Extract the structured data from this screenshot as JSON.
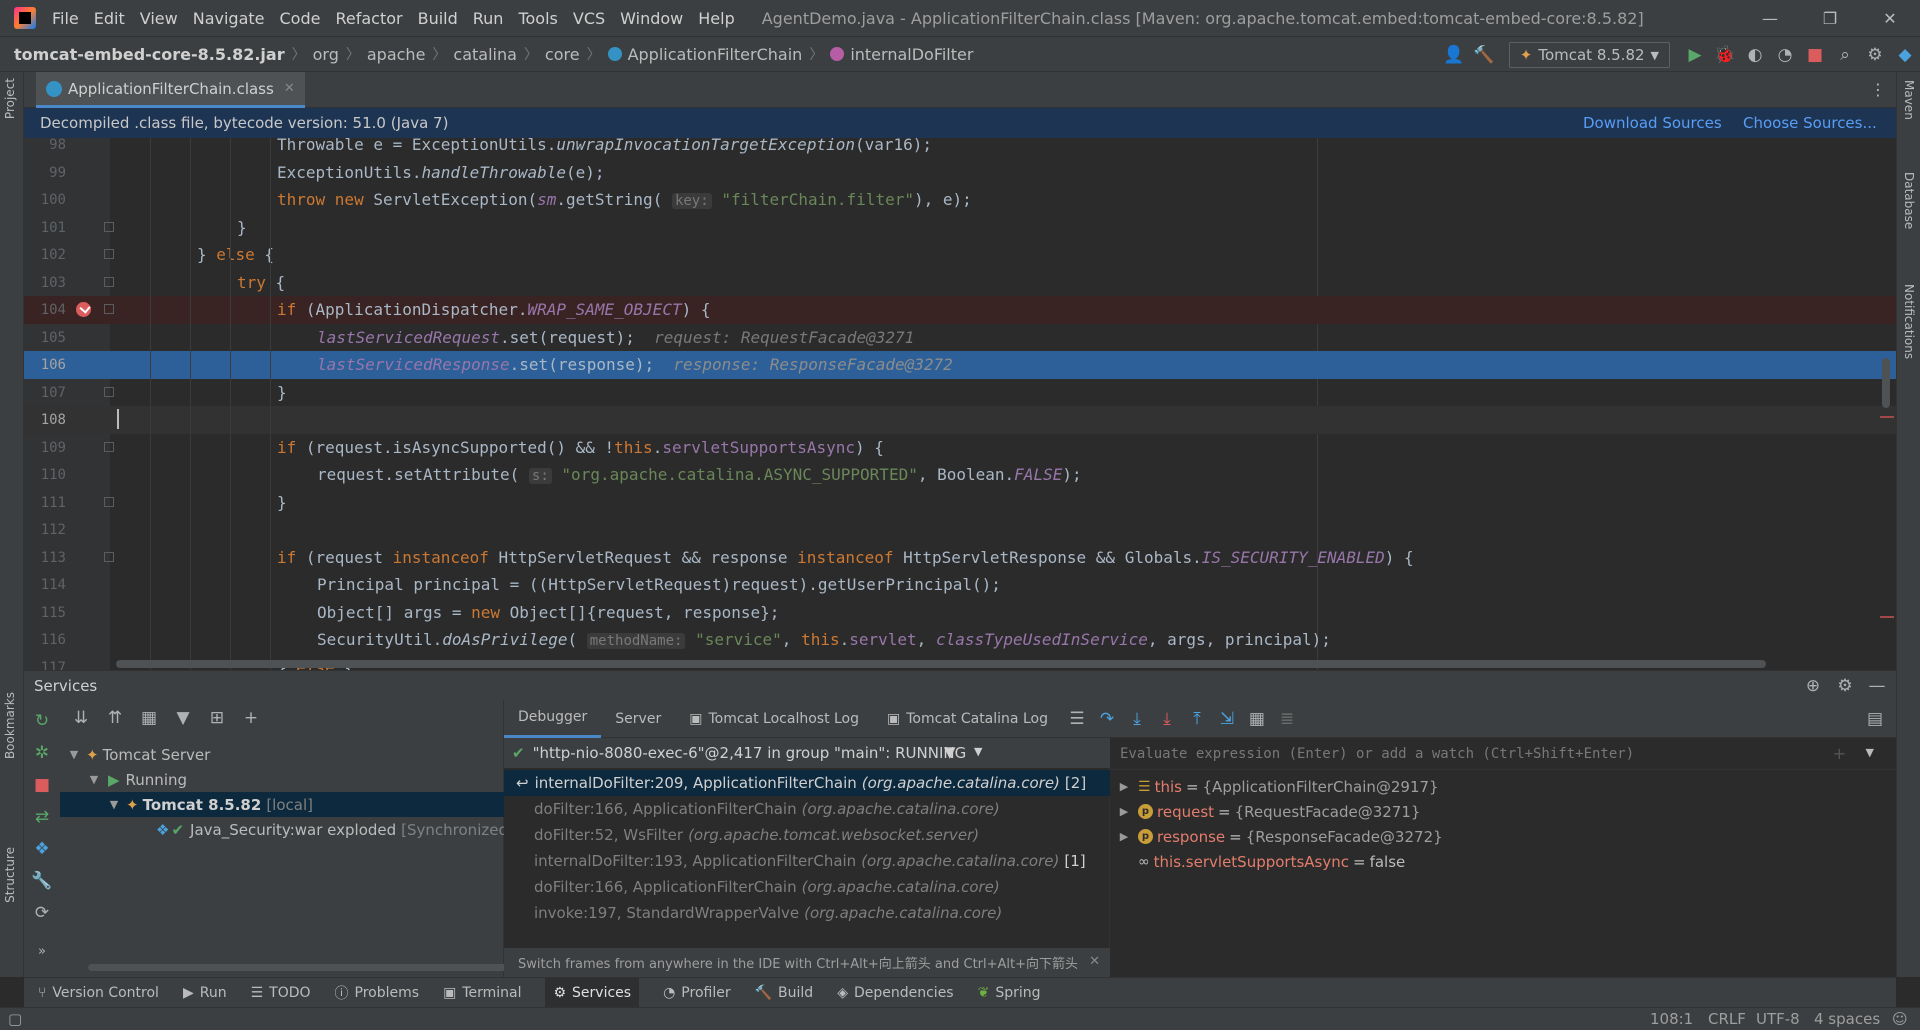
{
  "titlebar": {
    "menu": [
      "File",
      "Edit",
      "View",
      "Navigate",
      "Code",
      "Refactor",
      "Build",
      "Run",
      "Tools",
      "VCS",
      "Window",
      "Help"
    ],
    "title": "AgentDemo.java - ApplicationFilterChain.class [Maven: org.apache.tomcat.embed:tomcat-embed-core:8.5.82]"
  },
  "breadcrumbs": [
    "tomcat-embed-core-8.5.82.jar",
    "org",
    "apache",
    "catalina",
    "core",
    "ApplicationFilterChain",
    "internalDoFilter"
  ],
  "run_config": "Tomcat 8.5.82",
  "left_stripe": {
    "project": "Project",
    "bookmarks": "Bookmarks",
    "structure": "Structure"
  },
  "right_stripe": {
    "maven": "Maven",
    "database": "Database",
    "notifications": "Notifications"
  },
  "editor_tab": "ApplicationFilterChain.class",
  "banner": {
    "text": "Decompiled .class file, bytecode version: 51.0 (Java 7)",
    "download": "Download Sources",
    "choose": "Choose Sources..."
  },
  "code": {
    "l98": "98",
    "l99": "99",
    "l100": "100",
    "l101": "101",
    "l102": "102",
    "l103": "103",
    "l104": "104",
    "l105": "105",
    "l106": "106",
    "l107": "107",
    "l108": "108",
    "l109": "109",
    "l110": "110",
    "l111": "111",
    "l112": "112",
    "l113": "113",
    "l114": "114",
    "l115": "115",
    "l116": "116",
    "l117": "117"
  },
  "services": {
    "title": "Services",
    "tree": {
      "server": "Tomcat Server",
      "running": "Running",
      "tomcat": "Tomcat 8.5.82",
      "tomcat_tag": "[local]",
      "artifact": "Java_Security:war exploded",
      "artifact_tag": "[Synchronized]"
    }
  },
  "debugger": {
    "tabs": [
      "Debugger",
      "Server",
      "Tomcat Localhost Log",
      "Tomcat Catalina Log"
    ],
    "thread": "\"http-nio-8080-exec-6\"@2,417 in group \"main\": RUNNING",
    "frames": [
      {
        "method": "internalDoFilter:209, ApplicationFilterChain",
        "pkg": "(org.apache.catalina.core)",
        "tag": "[2]"
      },
      {
        "method": "doFilter:166, ApplicationFilterChain",
        "pkg": "(org.apache.catalina.core)",
        "tag": ""
      },
      {
        "method": "doFilter:52, WsFilter",
        "pkg": "(org.apache.tomcat.websocket.server)",
        "tag": ""
      },
      {
        "method": "internalDoFilter:193, ApplicationFilterChain",
        "pkg": "(org.apache.catalina.core)",
        "tag": "[1]"
      },
      {
        "method": "doFilter:166, ApplicationFilterChain",
        "pkg": "(org.apache.catalina.core)",
        "tag": ""
      },
      {
        "method": "invoke:197, StandardWrapperValve",
        "pkg": "(org.apache.catalina.core)",
        "tag": ""
      }
    ],
    "tip": "Switch frames from anywhere in the IDE with Ctrl+Alt+向上箭头 and Ctrl+Alt+向下箭头",
    "eval_placeholder": "Evaluate expression (Enter) or add a watch (Ctrl+Shift+Enter)",
    "vars": [
      {
        "name": "this",
        "value": "{ApplicationFilterChain@2917}"
      },
      {
        "name": "request",
        "value": "{RequestFacade@3271}"
      },
      {
        "name": "response",
        "value": "{ResponseFacade@3272}"
      },
      {
        "name": "this.servletSupportsAsync",
        "value": "false"
      }
    ]
  },
  "bottom_tools": [
    "Version Control",
    "Run",
    "TODO",
    "Problems",
    "Terminal",
    "Services",
    "Profiler",
    "Build",
    "Dependencies",
    "Spring"
  ],
  "status": {
    "position": "108:1",
    "line_sep": "CRLF",
    "encoding": "UTF-8",
    "indent": "4 spaces"
  }
}
